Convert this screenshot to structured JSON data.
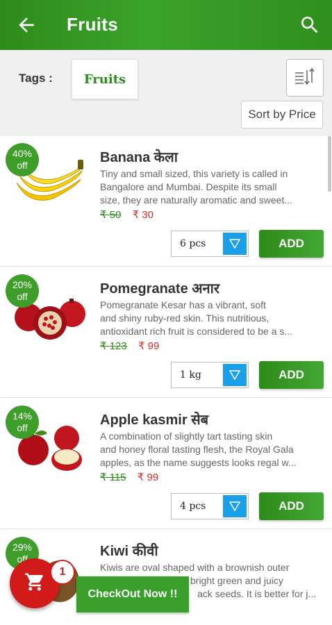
{
  "appbar": {
    "title": "Fruits",
    "back_icon": "arrow-left-icon",
    "search_icon": "search-icon"
  },
  "filters": {
    "tags_label": "Tags :",
    "tag": "Fruits",
    "sort_icon": "sort-ascending-icon",
    "sort_label": "Sort by Price"
  },
  "products": [
    {
      "name": "Banana केला",
      "discount_pct": "40%",
      "discount_suffix": "off",
      "desc": [
        "Tiny and small sized, this variety is called in",
        "Bangalore and Mumbai. Despite its small",
        "size, they are naturally aromatic and sweet..."
      ],
      "mrp": "₹ 50",
      "price": "₹ 30",
      "qty": "6 pcs",
      "add": "ADD"
    },
    {
      "name": "Pomegranate अनार",
      "discount_pct": "20%",
      "discount_suffix": "off",
      "desc": [
        "Pomegranate Kesar has a vibrant, soft",
        "and shiny ruby-red skin. This nutritious,",
        "antioxidant rich fruit is considered to be a s..."
      ],
      "mrp": "₹ 123",
      "price": "₹ 99",
      "qty": "1 kg",
      "add": "ADD"
    },
    {
      "name": "Apple kasmir  सेब",
      "discount_pct": "14%",
      "discount_suffix": "off",
      "desc": [
        "A combination of slightly tart tasting skin",
        "and honey floral tasting flesh, the Royal Gala",
        "apples, as the name suggests looks regal w..."
      ],
      "mrp": "₹ 115",
      "price": "₹ 99",
      "qty": "4 pcs",
      "add": "ADD"
    },
    {
      "name": "Kiwi कीवी",
      "discount_pct": "29%",
      "discount_suffix": "off",
      "desc": [
        "Kiwis are oval shaped with a brownish outer",
        "bright green and juicy",
        "ack seeds. It is better for j..."
      ],
      "mrp": "",
      "price": "",
      "qty": "",
      "add": ""
    }
  ],
  "cart": {
    "icon": "cart-icon",
    "count": "1",
    "checkout_label": "CheckOut Now !!"
  },
  "colors": {
    "primary": "#2e8b19",
    "badge": "#3f9e2a",
    "sale": "#d23030",
    "qty_button": "#1aa0e8",
    "fab": "#d11b1b"
  }
}
